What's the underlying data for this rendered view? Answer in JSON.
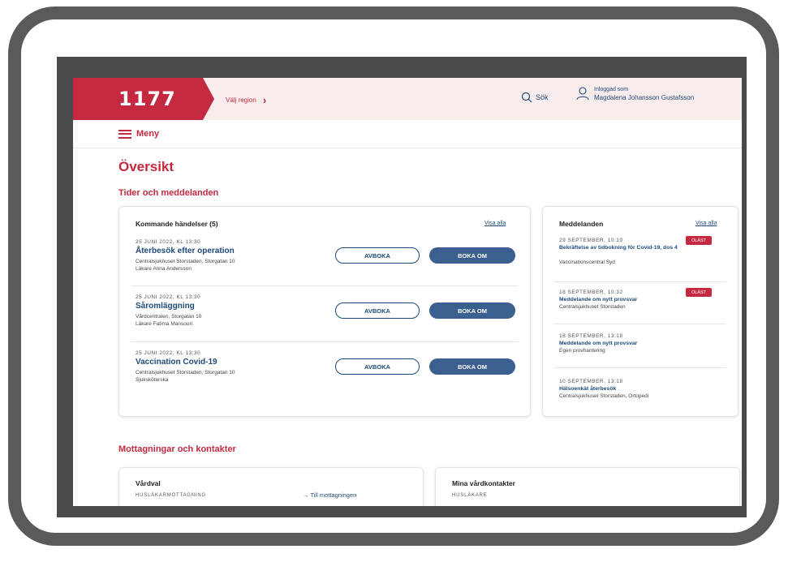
{
  "header": {
    "logo": "1177",
    "region_label": "Välj region",
    "search_label": "Sök",
    "user_caption": "Inloggad som",
    "user_name": "Magdalena Johansson Gustafsson"
  },
  "menu": {
    "label": "Meny"
  },
  "page_title": "Översikt",
  "section_times": "Tider och meddelanden",
  "events_card": {
    "title": "Kommande händelser (5)",
    "show_all": "Visa alla",
    "cancel_label": "AVBOKA",
    "rebook_label": "BOKA OM",
    "items": [
      {
        "date": "25 JUNI 2022, KL 13:30",
        "title": "Återbesök efter operation",
        "place": "Centralsjukhuset Storstaden, Storgatan 10",
        "person": "Läkare Anna Andersson"
      },
      {
        "date": "25 JUNI 2022, KL 13:30",
        "title": "Såromläggning",
        "place": "Vårdcentralen, Storgatan 10",
        "person": "Läkare Fatima Mansouri"
      },
      {
        "date": "25 JUNI 2022, KL 13:30",
        "title": "Vaccination Covid-19",
        "place": "Centralsjukhuset Storstaden, Storgatan 10",
        "person": "Sjuksköterska"
      }
    ]
  },
  "messages_card": {
    "title": "Meddelanden",
    "show_all": "Visa alla",
    "unread_badge": "OLÄST",
    "items": [
      {
        "date": "29 SEPTEMBER, 10:19",
        "title": "Bekräftelse av tidbokning för Covid-19, dos 4",
        "sender": "Vaccinationscentral Syd"
      },
      {
        "date": "18 SEPTEMBER, 10:32",
        "title": "Meddelande om nytt provsvar",
        "sender": "Centralsjukhuset Storstaden"
      },
      {
        "date": "18 SEPTEMBER, 13:18",
        "title": "Meddelande om nytt provsvar",
        "sender": "Egen provhantering"
      },
      {
        "date": "10 SEPTEMBER, 13:18",
        "title": "Hälsoenkät återbesök",
        "sender": "Centralsjukhuset Storstaden, Ortopedi"
      }
    ]
  },
  "section_contacts": "Mottagningar och kontakter",
  "care_choice_card": {
    "title": "Vårdval",
    "subhead": "HUSLÄKARMOTTAGNING",
    "link": "→ Till mottagningen"
  },
  "contacts_card": {
    "title": "Mina vårdkontakter",
    "subhead": "HUSLÄKARE"
  },
  "colors": {
    "brand_red": "#c4293f",
    "header_bg": "#f9eced",
    "link_blue": "#1e4a7a",
    "button_blue": "#3b5f8f"
  }
}
